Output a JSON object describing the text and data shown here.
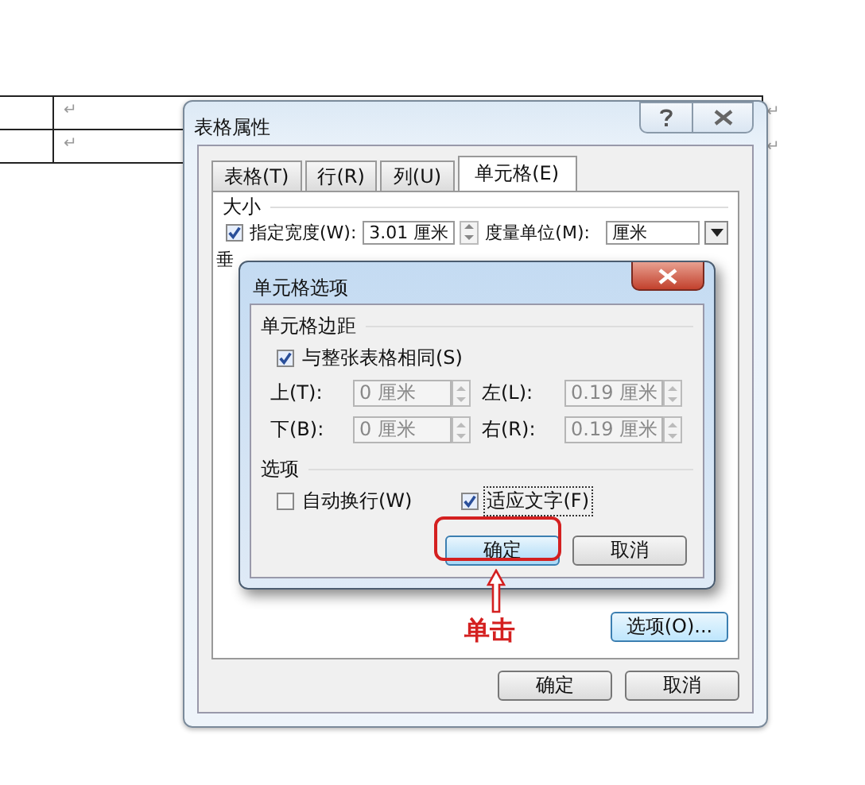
{
  "document_table": {
    "rows": [
      {
        "cells": [
          "",
          "↵"
        ],
        "end_mark": "↵"
      },
      {
        "cells": [
          "",
          "↵"
        ],
        "end_mark": "↵"
      }
    ]
  },
  "table_properties": {
    "title": "表格属性",
    "tabs": [
      {
        "label": "表格(T)",
        "selected": false
      },
      {
        "label": "行(R)",
        "selected": false
      },
      {
        "label": "列(U)",
        "selected": false
      },
      {
        "label": "单元格(E)",
        "selected": true
      }
    ],
    "size_heading": "大小",
    "width_checkbox": {
      "label": "指定宽度(W):",
      "checked": true
    },
    "width_value": "3.01 厘米",
    "unit_label": "度量单位(M):",
    "unit_value": "厘米",
    "partial_label": "垂",
    "options_button": "选项(O)...",
    "buttons": [
      "确定",
      "取消"
    ]
  },
  "cell_options": {
    "title": "单元格选项",
    "margins_heading": "单元格边距",
    "same_as_table": {
      "label": "与整张表格相同(S)",
      "checked": true
    },
    "margins": [
      {
        "label": "上(T):",
        "value": "0 厘米",
        "disabled": true
      },
      {
        "label": "左(L):",
        "value": "0.19 厘米",
        "disabled": true
      },
      {
        "label": "下(B):",
        "value": "0 厘米",
        "disabled": true
      },
      {
        "label": "右(R):",
        "value": "0.19 厘米",
        "disabled": true
      }
    ],
    "options_heading": "选项",
    "options": [
      {
        "label": "自动换行(W)",
        "checked": false,
        "focused": false
      },
      {
        "label": "适应文字(F)",
        "checked": true,
        "focused": true
      }
    ],
    "buttons": [
      {
        "label": "确定",
        "highlighted": true
      },
      {
        "label": "取消",
        "highlighted": false
      }
    ]
  },
  "annotation": {
    "text": "单击"
  }
}
